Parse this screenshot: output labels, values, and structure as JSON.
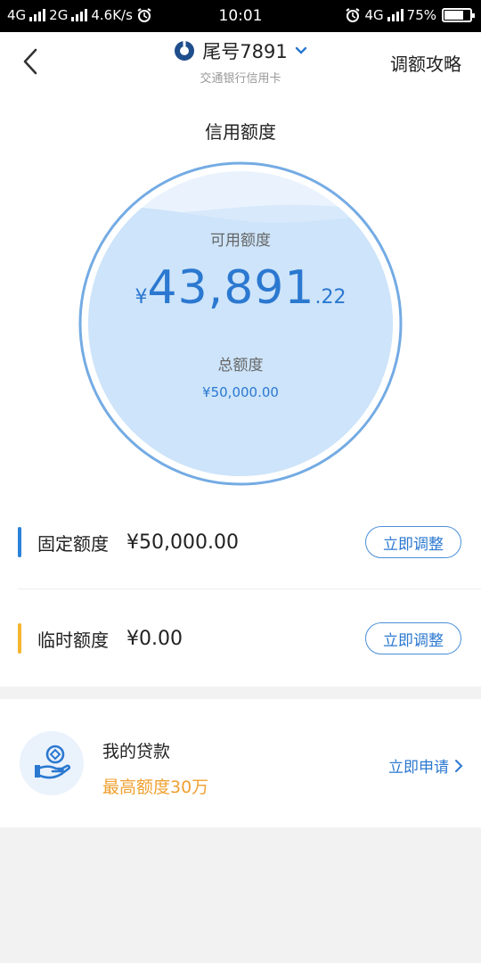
{
  "status_bar": {
    "net1": "4G",
    "net2": "2G",
    "speed": "4.6K/s",
    "time": "10:01",
    "net3": "4G",
    "battery": "75%",
    "battery_level": 0.75
  },
  "header": {
    "card_tail": "尾号7891",
    "bank_name": "交通银行信用卡",
    "guide_label": "调额攻略"
  },
  "credit": {
    "section_title": "信用额度",
    "available_label": "可用额度",
    "currency": "¥",
    "available_integer": "43,891",
    "available_decimal": ".22",
    "total_label": "总额度",
    "total_value": "¥50,000.00",
    "available_ratio": 0.878
  },
  "limits": [
    {
      "label": "固定额度",
      "value": "¥50,000.00",
      "button": "立即调整",
      "color": "#2b82da"
    },
    {
      "label": "临时额度",
      "value": "¥0.00",
      "button": "立即调整",
      "color": "#f5b52e"
    }
  ],
  "loan": {
    "title": "我的贷款",
    "subtitle": "最高额度30万",
    "apply_label": "立即申请"
  },
  "colors": {
    "accent": "#2b78d0",
    "orange": "#f0a030"
  }
}
